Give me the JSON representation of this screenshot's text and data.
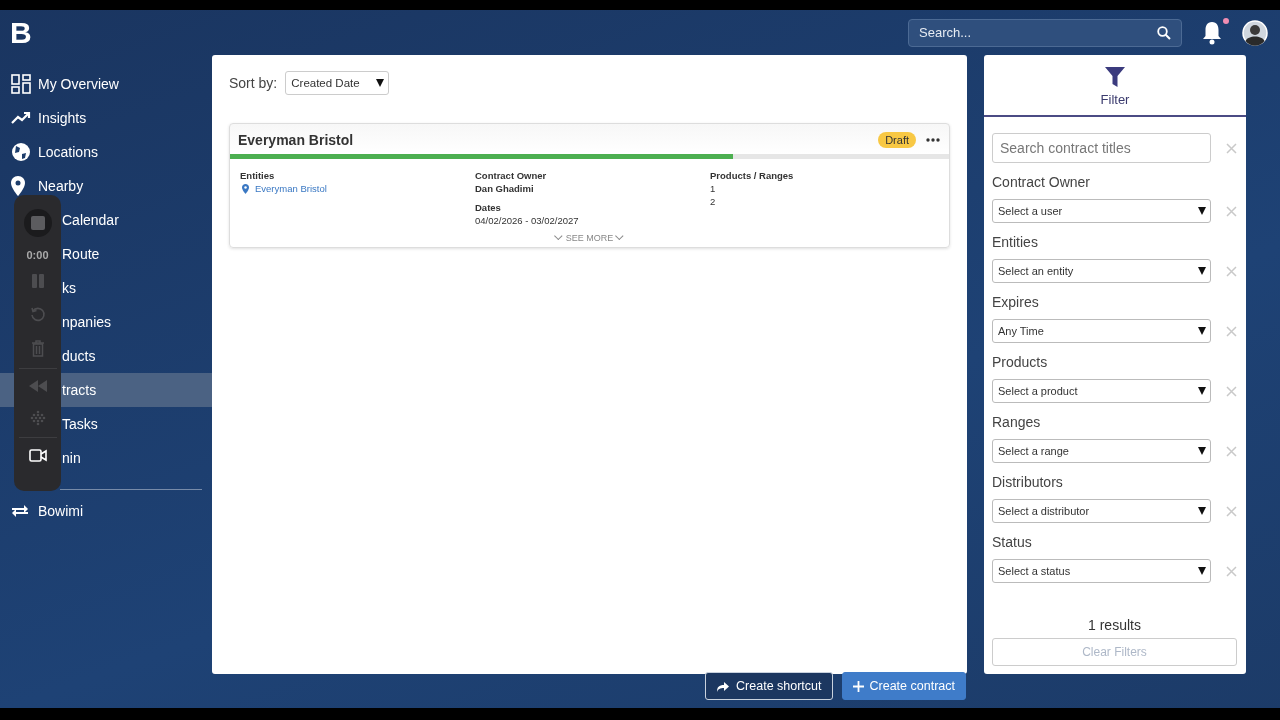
{
  "brand": {
    "logo": "B"
  },
  "search": {
    "placeholder": "Search..."
  },
  "notifications": {
    "unread": true
  },
  "sidebar": {
    "items": [
      {
        "label": "My Overview",
        "kind": "full",
        "selected": false
      },
      {
        "label": "Insights",
        "kind": "full",
        "selected": false
      },
      {
        "label": "Locations",
        "kind": "full",
        "selected": false
      },
      {
        "label": "Nearby",
        "kind": "full",
        "selected": false
      },
      {
        "label": "Calendar",
        "kind": "partial",
        "selected": false
      },
      {
        "label": "Route",
        "kind": "partial",
        "selected": false
      },
      {
        "label": "ks",
        "kind": "partial",
        "selected": false
      },
      {
        "label": "npanies",
        "kind": "partial",
        "selected": false
      },
      {
        "label": "ducts",
        "kind": "partial",
        "selected": false
      },
      {
        "label": "tracts",
        "kind": "partial",
        "selected": true
      },
      {
        "label": "Tasks",
        "kind": "partial",
        "selected": false
      },
      {
        "label": "nin",
        "kind": "partial",
        "selected": false
      }
    ],
    "footer_item": {
      "label": "Bowimi"
    }
  },
  "recorder": {
    "time": "0:00"
  },
  "sort": {
    "label": "Sort by:",
    "value": "Created Date"
  },
  "contracts": [
    {
      "title": "Everyman Bristol",
      "status": "Draft",
      "level": 0.7,
      "entities_label": "Entities",
      "entity": "Everyman Bristol",
      "owner_label": "Contract Owner",
      "owner": "Dan Ghadimi",
      "dates_label": "Dates",
      "dates": "04/02/2026 - 03/02/2027",
      "products_label": "Products / Ranges",
      "products": [
        "1",
        "2"
      ],
      "see_more": "SEE MORE"
    }
  ],
  "filter": {
    "title": "Filter",
    "search_placeholder": "Search contract titles",
    "fields": [
      {
        "label": "Contract Owner",
        "value": "Select a user"
      },
      {
        "label": "Entities",
        "value": "Select an entity"
      },
      {
        "label": "Expires",
        "value": "Any Time"
      },
      {
        "label": "Products",
        "value": "Select a product"
      },
      {
        "label": "Ranges",
        "value": "Select a range"
      },
      {
        "label": "Distributors",
        "value": "Select a distributor"
      },
      {
        "label": "Status",
        "value": "Select a status"
      }
    ],
    "results": "1 results",
    "clear": "Clear Filters",
    "clear_disabled": true
  },
  "actions": [
    {
      "label": "Create shortcut",
      "kind": "secondary"
    },
    {
      "label": "Create contract",
      "kind": "primary"
    }
  ]
}
